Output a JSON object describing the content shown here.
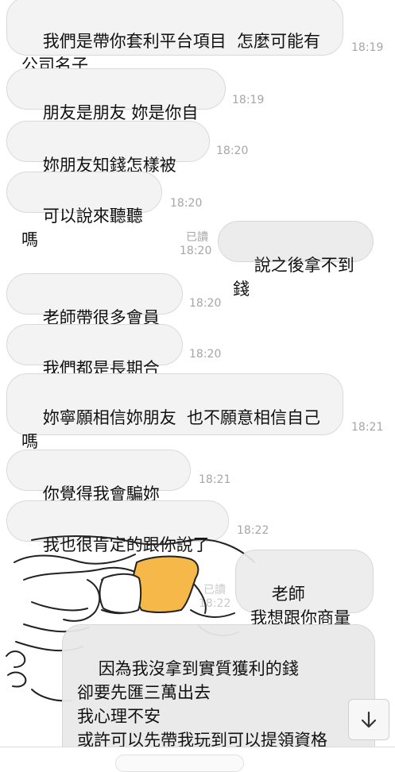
{
  "messages": {
    "m1": {
      "text": "我們是帶你套利平台項目  怎麼可能有\n公司名子",
      "time": "18:19"
    },
    "m2": {
      "text": "朋友是朋友 妳是你自己",
      "time": "18:19"
    },
    "m3": {
      "text": "妳朋友知錢怎樣被騙?",
      "time": "18:20"
    },
    "m4": {
      "text": "可以說來聽聽嗎",
      "time": "18:20"
    },
    "m5": {
      "text": "說之後拿不到錢",
      "time": "18:20",
      "read": "已讀"
    },
    "m6": {
      "text": "老師帶很多會員了",
      "time": "18:20"
    },
    "m7": {
      "text": "我們都是長期合作",
      "time": "18:20"
    },
    "m8": {
      "text": "妳寧願相信妳朋友  也不願意相信自己\n嗎",
      "time": "18:21"
    },
    "m9": {
      "text": "你覺得我會騙妳嗎?",
      "time": "18:21"
    },
    "m10": {
      "text": "我也很肯定的跟你說了",
      "time": "18:22"
    },
    "m11": {
      "text": "老師\n我想跟你商量",
      "read": "已讀",
      "time": "18:22"
    },
    "m12": {
      "text": "因為我沒拿到實質獲利的錢\n卻要先匯三萬出去\n我心理不安\n或許可以先帶我玩到可以提領資格\n然後能提領的時候"
    }
  },
  "colors": {
    "incoming_bubble": "#f3f3f3",
    "outgoing_bubble": "#ececec",
    "timestamp": "#a6a6a6",
    "sticker_shirt": "#f7b84a"
  },
  "icons": {
    "scroll_down": "arrow-down-icon"
  }
}
